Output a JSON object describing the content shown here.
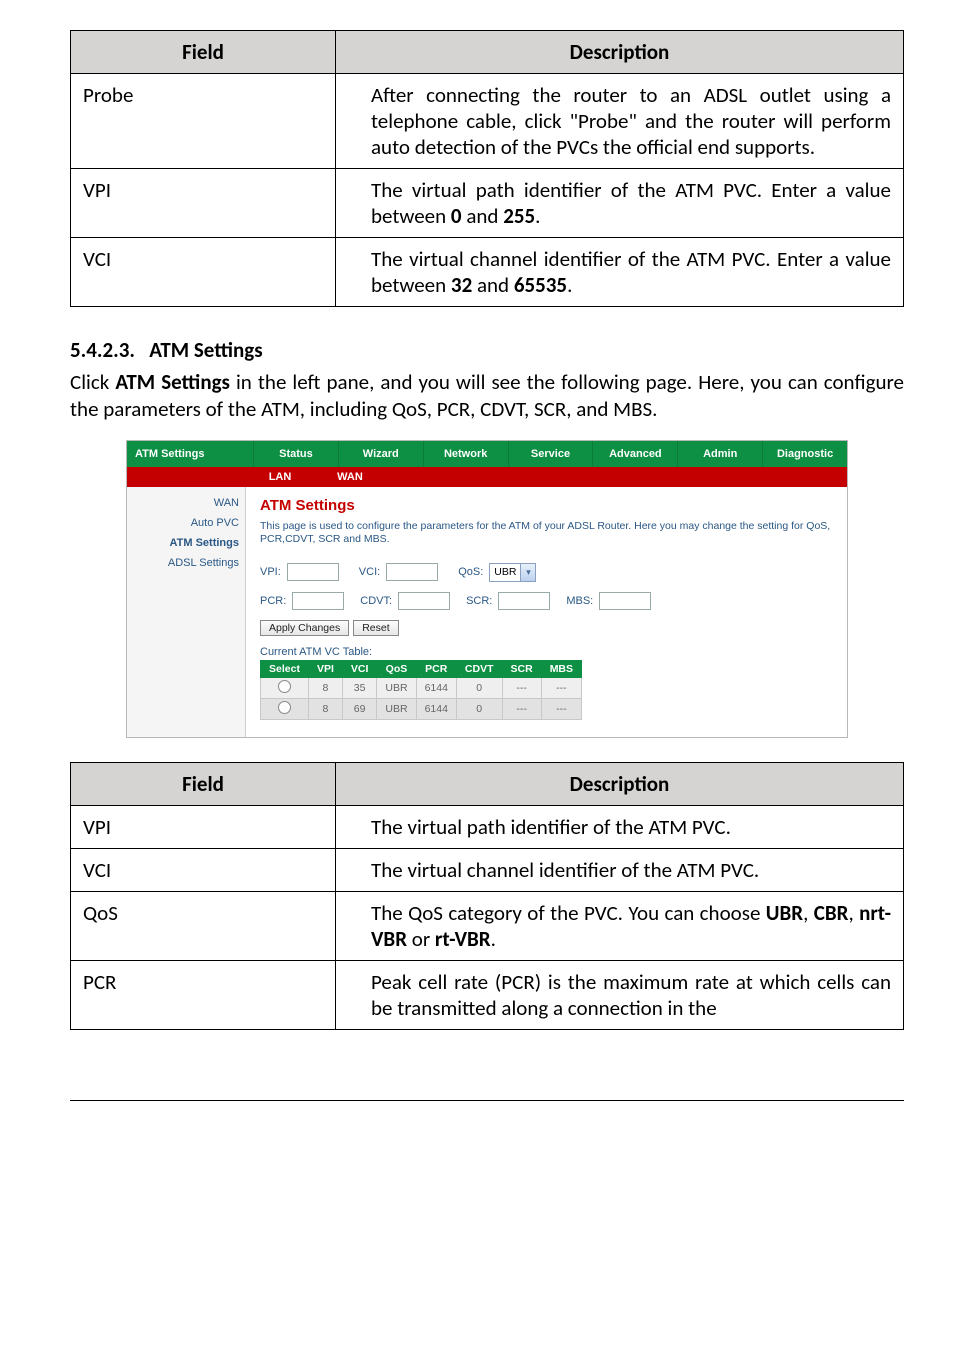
{
  "table1": {
    "headers": [
      "Field",
      "Description"
    ],
    "rows": [
      {
        "field": "Probe",
        "desc": "After connecting the router to an ADSL outlet using a telephone cable, click \"Probe\" and the router will perform auto detection of the PVCs the official end supports."
      },
      {
        "field": "VPI",
        "desc": "The virtual path identifier of the ATM PVC. Enter a value between <b>0</b> and <b>255</b>."
      },
      {
        "field": "VCI",
        "desc": "The virtual channel identifier of the ATM PVC. Enter a value between <b>32</b> and <b>65535</b>."
      }
    ]
  },
  "section": {
    "number": "5.4.2.3.",
    "title": "ATM Settings",
    "body": "Click <b>ATM Settings</b> in the left pane, and you will see the following page. Here, you can configure the parameters of the ATM, including QoS, PCR, CDVT, SCR, and MBS."
  },
  "screenshot": {
    "panel_title": "ATM Settings",
    "tabs": [
      "Status",
      "Wizard",
      "Network",
      "Service",
      "Advanced",
      "Admin",
      "Diagnostic"
    ],
    "subtabs": [
      "LAN",
      "WAN"
    ],
    "sidebar": [
      "WAN",
      "Auto PVC",
      "ATM Settings",
      "ADSL Settings"
    ],
    "heading": "ATM Settings",
    "note": "This page is used to configure the parameters for the ATM of your ADSL Router. Here you may change the setting for QoS, PCR,CDVT, SCR and MBS.",
    "labels": {
      "vpi": "VPI:",
      "vci": "VCI:",
      "qos": "QoS:",
      "pcr": "PCR:",
      "cdvt": "CDVT:",
      "scr": "SCR:",
      "mbs": "MBS:"
    },
    "qos_value": "UBR",
    "buttons": {
      "apply": "Apply Changes",
      "reset": "Reset"
    },
    "vc_heading": "Current ATM VC Table:",
    "vc_headers": [
      "Select",
      "VPI",
      "VCI",
      "QoS",
      "PCR",
      "CDVT",
      "SCR",
      "MBS"
    ],
    "vc_rows": [
      [
        "",
        "8",
        "35",
        "UBR",
        "6144",
        "0",
        "---",
        "---"
      ],
      [
        "",
        "8",
        "69",
        "UBR",
        "6144",
        "0",
        "---",
        "---"
      ]
    ]
  },
  "table2": {
    "headers": [
      "Field",
      "Description"
    ],
    "rows": [
      {
        "field": "VPI",
        "desc": "The virtual path identifier of the ATM PVC."
      },
      {
        "field": "VCI",
        "desc": "The virtual channel identifier of the ATM PVC."
      },
      {
        "field": "QoS",
        "desc": "The QoS category of the PVC. You can choose <b>UBR</b>, <b>CBR</b>, <b>nrt-VBR</b> or <b>rt-VBR</b>."
      },
      {
        "field": "PCR",
        "desc": "Peak cell rate (PCR) is the maximum rate at which cells can be transmitted along a connection in the"
      }
    ]
  }
}
